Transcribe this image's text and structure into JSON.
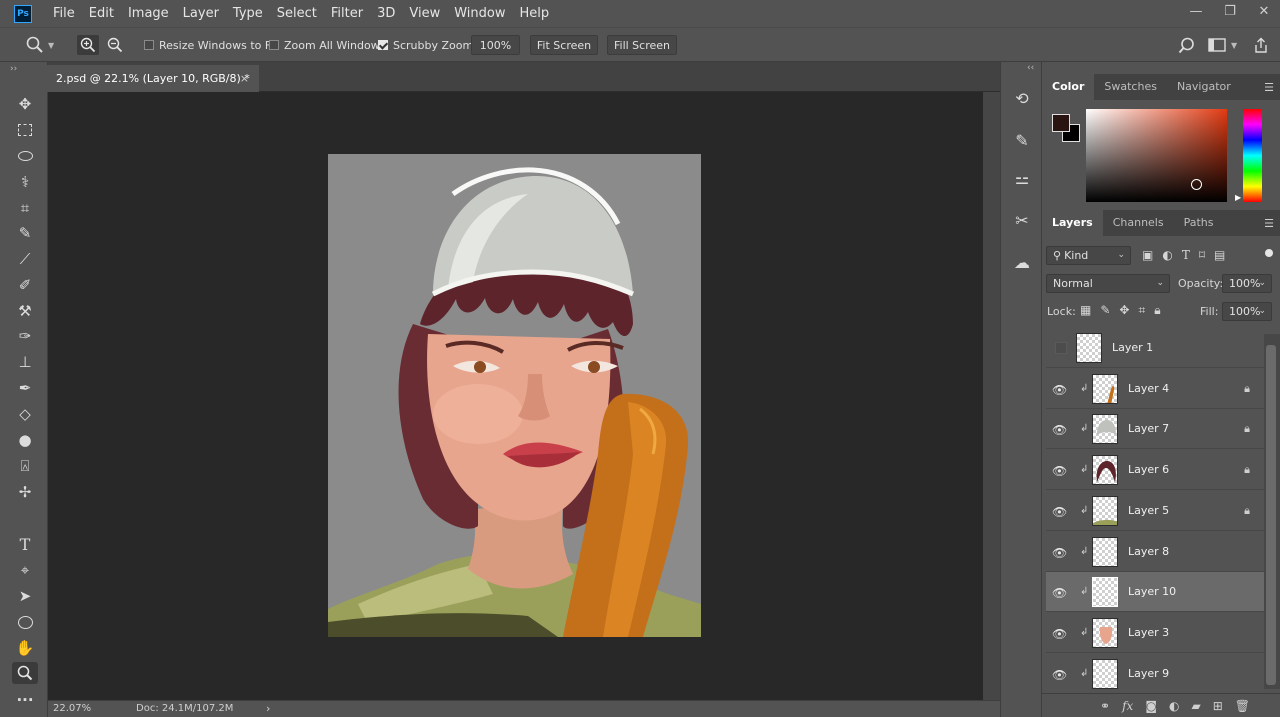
{
  "app": {
    "logo": "Ps"
  },
  "menu": [
    "File",
    "Edit",
    "Image",
    "Layer",
    "Type",
    "Select",
    "Filter",
    "3D",
    "View",
    "Window",
    "Help"
  ],
  "window_controls": {
    "minimize": "—",
    "restore": "❐",
    "close": "✕"
  },
  "options": {
    "resize_windows_to_fit": {
      "label": "Resize Windows to Fit",
      "checked": false
    },
    "zoom_all_windows": {
      "label": "Zoom All Windows",
      "checked": false
    },
    "scrubby_zoom": {
      "label": "Scrubby Zoom",
      "checked": true
    },
    "zoom_value": "100%",
    "fit_screen": "Fit Screen",
    "fill_screen": "Fill Screen"
  },
  "document": {
    "tab_title": "2.psd @ 22.1% (Layer 10, RGB/8) *",
    "close": "×"
  },
  "status": {
    "zoom": "22.07%",
    "doc": "Doc: 24.1M/107.2M",
    "arrow": "›"
  },
  "color_panel": {
    "tabs": [
      "Color",
      "Swatches",
      "Navigator"
    ],
    "active_tab": "Color",
    "foreground": "#2a1412",
    "background": "#000000",
    "hue_color": "#e23a12"
  },
  "layers_panel": {
    "tabs": [
      "Layers",
      "Channels",
      "Paths"
    ],
    "active_tab": "Layers",
    "filter_kind": "Kind",
    "blend_mode": "Normal",
    "opacity_label": "Opacity:",
    "opacity_value": "100%",
    "lock_label": "Lock:",
    "fill_label": "Fill:",
    "fill_value": "100%",
    "layers": [
      {
        "name": "Layer 1",
        "visible": false,
        "clipped": false,
        "locked": false,
        "selected": false,
        "thumb": "empty"
      },
      {
        "name": "Layer 4",
        "visible": true,
        "clipped": true,
        "locked": true,
        "selected": false,
        "thumb": "bat"
      },
      {
        "name": "Layer 7",
        "visible": true,
        "clipped": true,
        "locked": true,
        "selected": false,
        "thumb": "cap"
      },
      {
        "name": "Layer 6",
        "visible": true,
        "clipped": true,
        "locked": true,
        "selected": false,
        "thumb": "hair"
      },
      {
        "name": "Layer 5",
        "visible": true,
        "clipped": true,
        "locked": true,
        "selected": false,
        "thumb": "shirt"
      },
      {
        "name": "Layer 8",
        "visible": true,
        "clipped": true,
        "locked": false,
        "selected": false,
        "thumb": "empty"
      },
      {
        "name": "Layer 10",
        "visible": true,
        "clipped": true,
        "locked": false,
        "selected": true,
        "thumb": "empty"
      },
      {
        "name": "Layer 3",
        "visible": true,
        "clipped": true,
        "locked": false,
        "selected": false,
        "thumb": "face"
      },
      {
        "name": "Layer 9",
        "visible": true,
        "clipped": true,
        "locked": false,
        "selected": false,
        "thumb": "empty"
      }
    ]
  },
  "icons": {
    "zoom_tool": "zoom-icon",
    "zoom_in": "zoom-in-icon",
    "zoom_out": "zoom-out-icon",
    "search": "search-icon",
    "workspace": "workspace-icon",
    "share": "share-icon",
    "eye": "eye-icon",
    "lock": "lock-icon",
    "clip": "clip-arrow-icon"
  },
  "tools": [
    "move-tool-icon",
    "marquee-tool-icon",
    "lasso-tool-icon",
    "magic-wand-tool-icon",
    "crop-tool-icon",
    "eyedropper-tool-icon",
    "healing-brush-tool-icon",
    "brush-tool-icon",
    "clone-stamp-tool-icon",
    "history-brush-tool-icon",
    "eraser-tool-icon",
    "paint-bucket-tool-icon",
    "blur-tool-icon",
    "dodge-tool-icon",
    "pen-tool-icon",
    "type-tool-icon",
    "path-selection-tool-icon",
    "ellipse-tool-icon",
    "hand-tool-icon",
    "zoom-tool-icon",
    "more-tools-icon"
  ]
}
